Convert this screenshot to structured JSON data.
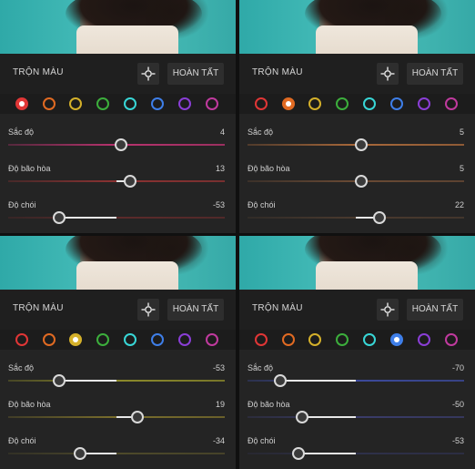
{
  "panels": [
    {
      "title": "TRỘN MÀU",
      "done_label": "HOÀN TẤT",
      "selected_swatch": 0,
      "sliders": [
        {
          "label": "Sắc độ",
          "value": "4",
          "num": 4
        },
        {
          "label": "Độ bão hòa",
          "value": "13",
          "num": 13
        },
        {
          "label": "Độ chói",
          "value": "-53",
          "num": -53
        }
      ],
      "track_colors": [
        "#b8326e",
        "#8c3232",
        "#5c2a2a"
      ]
    },
    {
      "title": "TRỘN MÀU",
      "done_label": "HOÀN TẤT",
      "selected_swatch": 1,
      "sliders": [
        {
          "label": "Sắc độ",
          "value": "5",
          "num": 5
        },
        {
          "label": "Độ bão hòa",
          "value": "5",
          "num": 5
        },
        {
          "label": "Độ chói",
          "value": "22",
          "num": 22
        }
      ],
      "track_colors": [
        "#a8683a",
        "#6a4a34",
        "#4a3a2e"
      ]
    },
    {
      "title": "TRỘN MÀU",
      "done_label": "HOÀN TẤT",
      "selected_swatch": 2,
      "sliders": [
        {
          "label": "Sắc độ",
          "value": "-53",
          "num": -53
        },
        {
          "label": "Độ bão hòa",
          "value": "19",
          "num": 19
        },
        {
          "label": "Độ chói",
          "value": "-34",
          "num": -34
        }
      ],
      "track_colors": [
        "#8c8a2a",
        "#7a6e2c",
        "#4e4a2a"
      ]
    },
    {
      "title": "TRỘN MÀU",
      "done_label": "HOÀN TẤT",
      "selected_swatch": 5,
      "sliders": [
        {
          "label": "Sắc độ",
          "value": "-70",
          "num": -70
        },
        {
          "label": "Độ bão hòa",
          "value": "-50",
          "num": -50
        },
        {
          "label": "Độ chói",
          "value": "-53",
          "num": -53
        }
      ],
      "track_colors": [
        "#3c4a9c",
        "#3a3c6a",
        "#2e304a"
      ]
    }
  ],
  "swatch_colors": [
    {
      "name": "red",
      "hex": "#e03636"
    },
    {
      "name": "orange",
      "hex": "#e06a22"
    },
    {
      "name": "yellow",
      "hex": "#d4b02a"
    },
    {
      "name": "green",
      "hex": "#3cae3c"
    },
    {
      "name": "aqua",
      "hex": "#38d6d6"
    },
    {
      "name": "blue",
      "hex": "#3e7ee8"
    },
    {
      "name": "purple",
      "hex": "#8a3ed6"
    },
    {
      "name": "magenta",
      "hex": "#c03a9e"
    }
  ],
  "icons": {
    "target": "target-adjust-icon"
  },
  "colors": {
    "thumb_border": "#d9d9d9",
    "fill": "#e8e8e8"
  }
}
